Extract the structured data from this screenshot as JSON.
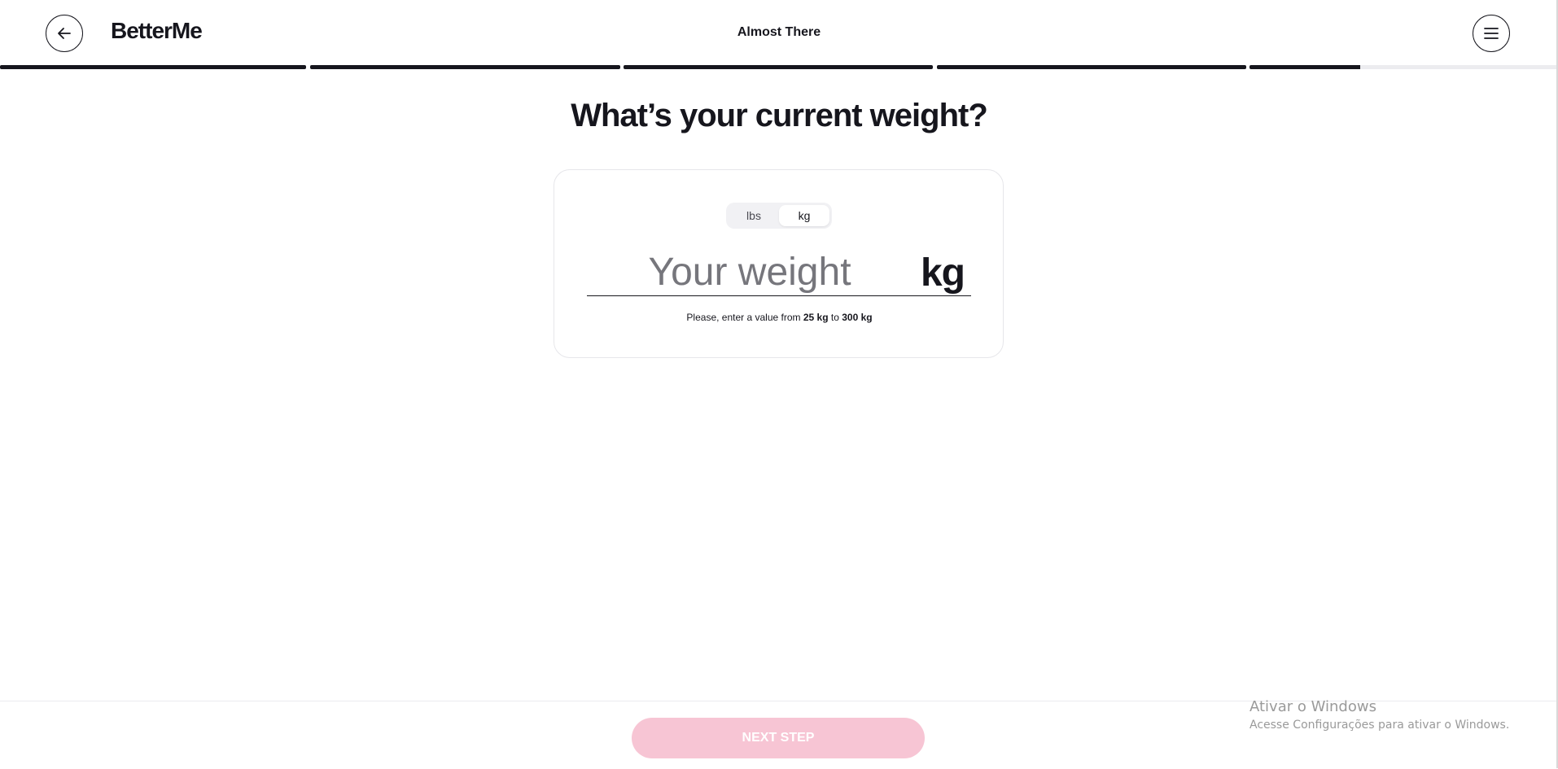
{
  "header": {
    "brand": "BetterMe",
    "title": "Almost There",
    "back_icon": "arrow-left-icon",
    "menu_icon": "hamburger-menu-icon"
  },
  "progress": {
    "segments": [
      1,
      1,
      1,
      1,
      0.36
    ]
  },
  "main": {
    "question": "What’s your current weight?",
    "units": [
      "lbs",
      "kg"
    ],
    "selected_unit": "kg",
    "weight_placeholder": "Your weight",
    "weight_value": "",
    "weight_unit_label": "kg",
    "hint": {
      "prefix": "Please, enter a value from ",
      "min": "25 kg",
      "middle": " to ",
      "max": "300 kg"
    }
  },
  "footer": {
    "next_label": "NEXT STEP"
  },
  "watermark": {
    "title": "Ativar o Windows",
    "subtitle": "Acesse Configurações para ativar o Windows."
  },
  "colors": {
    "text": "#16161d",
    "progress_filled": "#16161d",
    "progress_empty": "#ececef",
    "button_disabled": "#f7c5d4"
  }
}
